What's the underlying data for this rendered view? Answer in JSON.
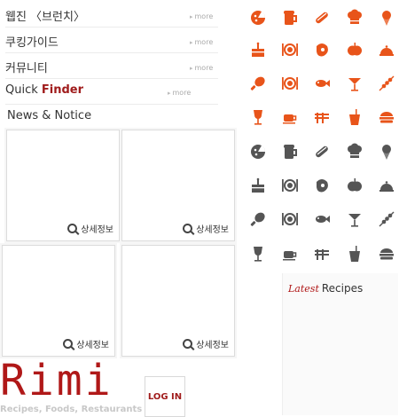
{
  "menu": [
    {
      "label": "웹진 〈브런치〉",
      "more": "more"
    },
    {
      "label": "쿠킹가이드",
      "more": "more"
    },
    {
      "label": "커뮤니티",
      "more": "more"
    }
  ],
  "quick_finder": {
    "quick": "Quick",
    "finder": "Finder",
    "more": "more"
  },
  "news": {
    "title": "News & Notice"
  },
  "cards": [
    {
      "detail": "상세정보"
    },
    {
      "detail": "상세정보"
    },
    {
      "detail": "상세정보"
    },
    {
      "detail": "상세정보"
    }
  ],
  "logo": {
    "text": "Rimi",
    "subtitle": "Recipes, Foods, Restaurants"
  },
  "login": {
    "label": "LOG IN"
  },
  "latest_recipes": {
    "italic": "Latest",
    "label": "Recipes"
  },
  "colors": {
    "accent": "#e8541a",
    "dark": "#555555",
    "brand": "#b01818"
  },
  "icons_color": [
    "pizza",
    "beer",
    "hotdog",
    "chef-hat",
    "ice-cream",
    "cake",
    "plate-cutlery",
    "steak",
    "apple",
    "cloche",
    "drumstick",
    "plate-cutlery",
    "fish",
    "cocktail",
    "skewer",
    "wine",
    "coffee",
    "noodles",
    "soda",
    "burger"
  ],
  "icons_gray": [
    "pizza",
    "beer",
    "hotdog",
    "chef-hat",
    "ice-cream",
    "cake",
    "plate-cutlery",
    "steak",
    "apple",
    "cloche",
    "drumstick",
    "plate-cutlery",
    "fish",
    "cocktail",
    "skewer",
    "wine",
    "coffee",
    "noodles",
    "soda",
    "burger"
  ]
}
